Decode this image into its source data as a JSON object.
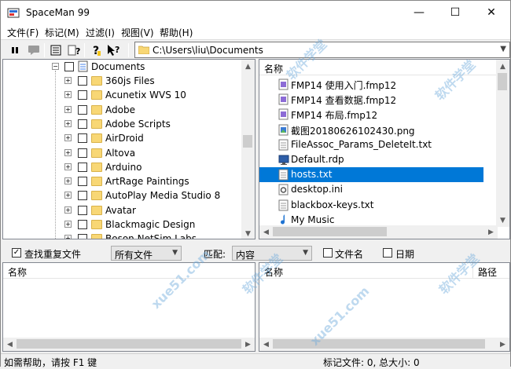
{
  "app": {
    "title": "SpaceMan 99",
    "minimize": "—",
    "maximize": "☐",
    "close": "✕"
  },
  "menu": [
    "文件(F)",
    "标记(M)",
    "过滤(I)",
    "视图(V)",
    "帮助(H)"
  ],
  "toolbar": {
    "path": "C:\\Users\\liu\\Documents",
    "icons": [
      "pause-icon",
      "comment-icon",
      "view-icon",
      "help-topics-icon",
      "about-icon",
      "context-help-icon"
    ]
  },
  "tree": {
    "root": "Documents",
    "items": [
      "360js Files",
      "Acunetix WVS 10",
      "Adobe",
      "Adobe Scripts",
      "AirDroid",
      "Altova",
      "Arduino",
      "ArtRage Paintings",
      "AutoPlay Media Studio 8",
      "Avatar",
      "Blackmagic Design",
      "Boson NetSim Labs"
    ]
  },
  "files": {
    "header": "名称",
    "items": [
      {
        "name": "FMP14 使用入门.fmp12",
        "type": "doc"
      },
      {
        "name": "FMP14 查看数据.fmp12",
        "type": "doc"
      },
      {
        "name": "FMP14 布局.fmp12",
        "type": "doc"
      },
      {
        "name": "截图20180626102430.png",
        "type": "image"
      },
      {
        "name": "FileAssoc_Params_DeleteIt.txt",
        "type": "text"
      },
      {
        "name": "Default.rdp",
        "type": "rdp"
      },
      {
        "name": "hosts.txt",
        "type": "text",
        "selected": true
      },
      {
        "name": "desktop.ini",
        "type": "ini"
      },
      {
        "name": "blackbox-keys.txt",
        "type": "text"
      },
      {
        "name": "My Music",
        "type": "music"
      }
    ]
  },
  "find": {
    "checkbox_label": "查找重复文件",
    "checked": true,
    "filter_value": "所有文件",
    "match_label": "匹配:",
    "match_value": "内容",
    "filename_label": "文件名",
    "date_label": "日期"
  },
  "results": {
    "left_header": "名称",
    "right_header": "名称",
    "path_header": "路径"
  },
  "status": {
    "left": "如需帮助，请按 F1 键",
    "right": "标记文件: 0,  总大小: 0"
  },
  "watermark": [
    "软件学堂",
    "xue51.com"
  ],
  "colors": {
    "selection": "#0078d7",
    "folder": "#f8d775"
  }
}
